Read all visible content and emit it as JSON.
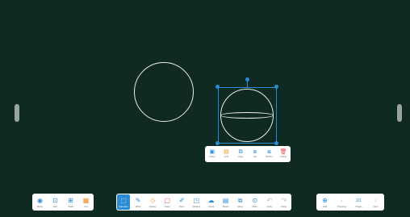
{
  "colors": {
    "board": "#0f2a22",
    "accent": "#2a8bd6",
    "toolbar_bg": "#ffffff"
  },
  "context_toolbar": [
    {
      "label": "Colour",
      "icon": "palette-icon"
    },
    {
      "label": "Lock",
      "icon": "lock-icon"
    },
    {
      "label": "Copy",
      "icon": "copy-icon"
    },
    {
      "label": "Top",
      "icon": "bring-to-top-icon"
    },
    {
      "label": "Bottom",
      "icon": "send-to-bottom-icon"
    },
    {
      "label": "Delete",
      "icon": "trash-icon"
    }
  ],
  "left_toolbar": [
    {
      "label": "Menu",
      "icon": "menu-icon"
    },
    {
      "label": "Exit",
      "icon": "exit-icon"
    },
    {
      "label": "Tools",
      "icon": "apps-icon"
    },
    {
      "label": "Cut",
      "icon": "cut-icon"
    }
  ],
  "center_toolbar": [
    {
      "label": "Selection",
      "icon": "cursor-icon",
      "active": true
    },
    {
      "label": "Write",
      "icon": "pen-icon"
    },
    {
      "label": "Eraser",
      "icon": "eraser-icon"
    },
    {
      "label": "Clear",
      "icon": "clear-icon"
    },
    {
      "label": "Pens",
      "icon": "marker-icon"
    },
    {
      "label": "Shapes",
      "icon": "shapes-icon"
    },
    {
      "label": "Cloud",
      "icon": "cloud-icon"
    },
    {
      "label": "Board",
      "icon": "board-icon"
    },
    {
      "label": "Move",
      "icon": "move-icon"
    },
    {
      "label": "More",
      "icon": "more-icon"
    },
    {
      "label": "Undo",
      "icon": "undo-icon"
    },
    {
      "label": "Redo",
      "icon": "redo-icon"
    }
  ],
  "right_toolbar": [
    {
      "label": "Add",
      "icon": "add-icon"
    },
    {
      "label": "Previous",
      "icon": "chevron-left-icon"
    },
    {
      "label": "Pages",
      "icon": "pages-icon",
      "value": "1/1"
    },
    {
      "label": "Next",
      "icon": "chevron-right-icon"
    }
  ]
}
